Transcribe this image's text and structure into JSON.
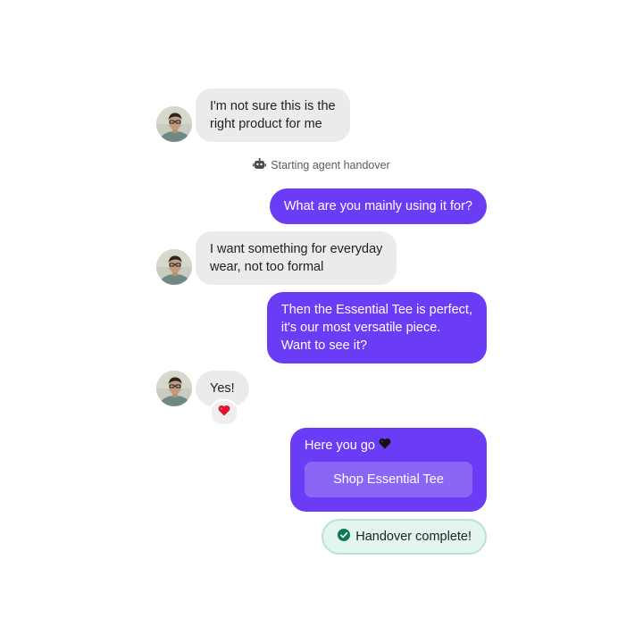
{
  "messages": [
    {
      "id": "m1",
      "direction": "incoming",
      "text": "I'm not sure this is the\nright product for me"
    },
    {
      "id": "m2",
      "direction": "outgoing",
      "text": "What are you mainly using it for?"
    },
    {
      "id": "m3",
      "direction": "incoming",
      "text": "I want something for everyday\nwear, not too formal"
    },
    {
      "id": "m4",
      "direction": "outgoing",
      "text": "Then the Essential Tee is perfect,\nit's our most versatile piece.\nWant to see it?"
    },
    {
      "id": "m5",
      "direction": "incoming",
      "text": "Yes!",
      "reaction": "heart"
    }
  ],
  "system_notice": {
    "icon": "robot-icon",
    "text": "Starting agent handover"
  },
  "product_card": {
    "text": "Here you go",
    "emoji": "black-heart",
    "button_label": "Shop Essential Tee"
  },
  "status": {
    "icon": "check-circle-icon",
    "text": "Handover complete!",
    "color": "#0e7a55"
  },
  "colors": {
    "outgoing_bubble": "#6a3cf5",
    "incoming_bubble": "#ebebeb",
    "status_bg": "#e2f5ee",
    "status_border": "#b9e3d3",
    "reaction_heart": "#e0142c"
  }
}
